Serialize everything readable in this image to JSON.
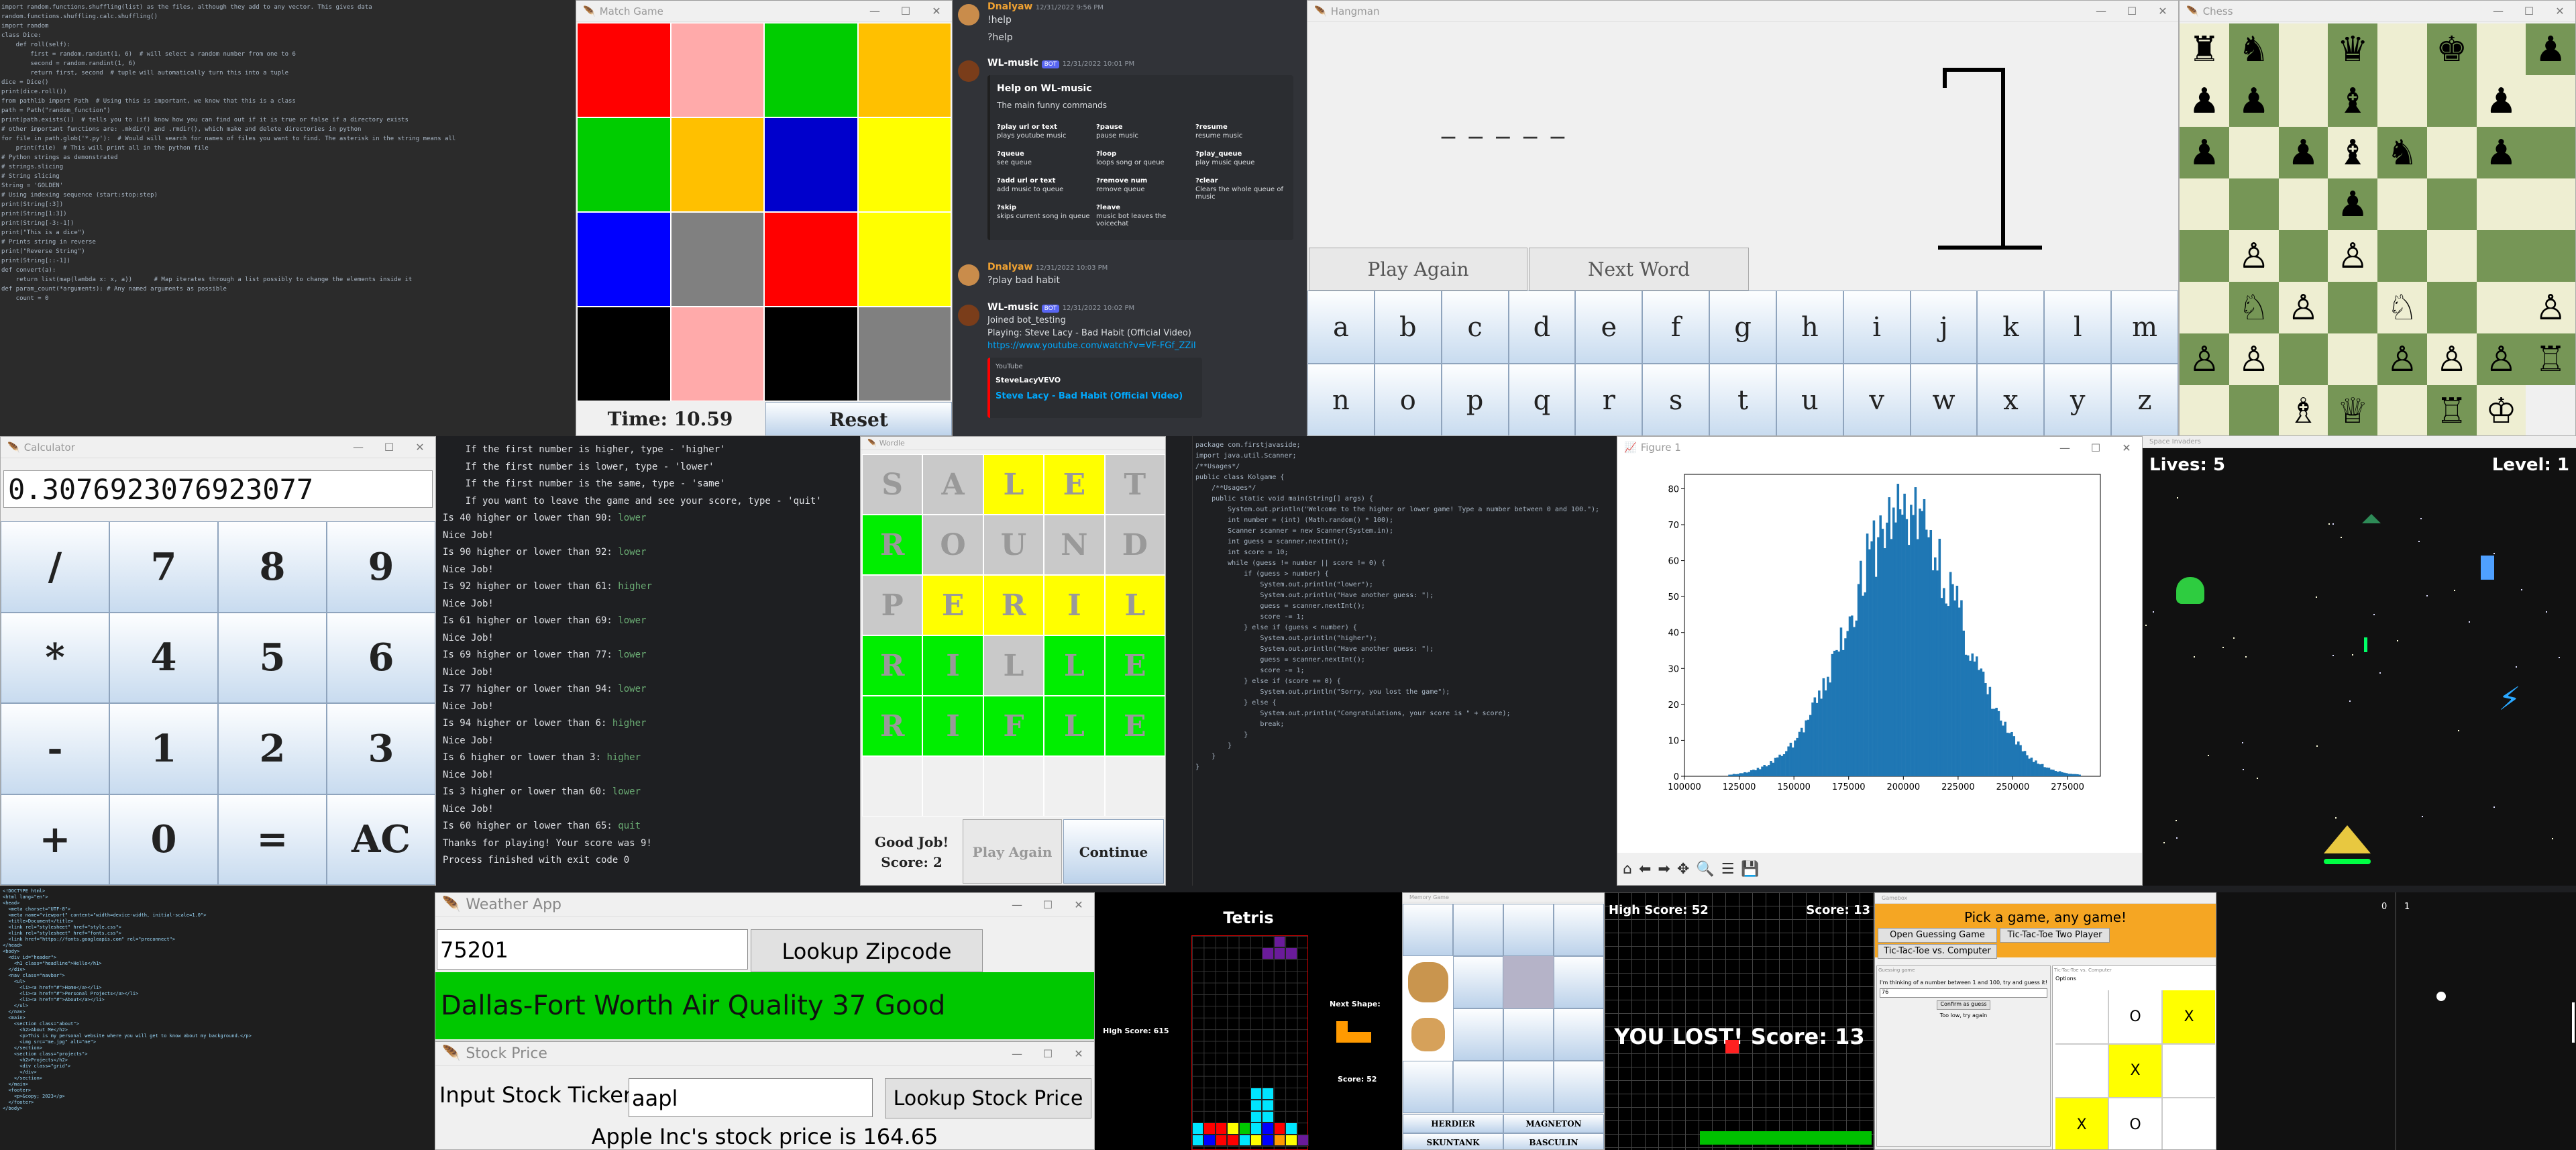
{
  "editor_tl": {
    "lines": [
      "import random.functions.shuffling(list) as the files, although they add to any vector. This gives data",
      "random.functions.shuffling.calc.shuffling()",
      "",
      "import random",
      "",
      "",
      "class Dice:",
      "    def roll(self):",
      "        first = random.randint(1, 6)  # will select a random number from one to 6",
      "        second = random.randint(1, 6)",
      "        return first, second  # tuple will automatically turn this into a tuple",
      "",
      "dice = Dice()",
      "print(dice.roll())",
      "",
      "from pathlib import Path  # Using this is important, we know that this is a class",
      "",
      "path = Path(\"random_function\")",
      "print(path.exists())  # tells you to (if) know how you can find out if it is true or false if a directory exists",
      "# other important functions are: .mkdir() and .rmdir(), which make and delete directories in python",
      "",
      "for file in path.glob('*.py'):  # Would will search for names of files you want to find. The asterisk in the string means all",
      "    print(file)  # This will print all in the python file",
      "",
      "# Python strings as demonstrated",
      "# strings.slicing",
      "",
      "# String slicing",
      "String = 'GOLDEN'",
      "",
      "# Using indexing sequence (start:stop:step)",
      "print(String[:3])",
      "print(String[1:3])",
      "print(String[-3:-1])",
      "print(\"This is a dice\")",
      "",
      "# Prints string in reverse",
      "print(\"Reverse String\")",
      "print(String[::-1])",
      "",
      "",
      "def convert(a):",
      "    return list(map(lambda x: x, a))      # Map iterates through a list possibly to change the elements inside it",
      "",
      "def param_count(*arguments): # Any named arguments as possible",
      "    count = 0"
    ]
  },
  "match_game": {
    "title": "Match Game",
    "colors": [
      "#ff0000",
      "#ffaaaa",
      "#00cc00",
      "#ffc000",
      "#00cc00",
      "#ffc000",
      "#0000cc",
      "#ffff00",
      "#0000ff",
      "#808080",
      "#ff0000",
      "#ffff00",
      "#000000",
      "#ffaaaa",
      "#000000",
      "#808080"
    ],
    "time": "Time: 10.59",
    "reset": "Reset"
  },
  "discord": {
    "messages": [
      {
        "user": "Dnalyaw",
        "time": "12/31/2022 9:56 PM",
        "lines": [
          "!help",
          "?help"
        ]
      },
      {
        "user": "WL-music",
        "bot": "BOT",
        "time": "12/31/2022 10:01 PM"
      },
      {
        "user": "Dnalyaw",
        "time": "12/31/2022 10:03 PM",
        "lines": [
          "?play bad habit"
        ]
      },
      {
        "user": "WL-music",
        "bot": "BOT",
        "time": "12/31/2022 10:02 PM",
        "lines": [
          "Joined bot_testing",
          "Playing: Steve Lacy - Bad Habit (Official Video)"
        ]
      }
    ],
    "help_title": "Help on WL-music",
    "help_sub": "The main funny commands",
    "commands": [
      [
        "?play url or text",
        "plays youtube music"
      ],
      [
        "?pause",
        "pause music"
      ],
      [
        "?resume",
        "resume music"
      ],
      [
        "?queue",
        "see queue"
      ],
      [
        "?loop",
        "loops song or queue"
      ],
      [
        "?play_queue",
        "play music queue"
      ],
      [
        "?add url or text",
        "add music to queue"
      ],
      [
        "?remove num",
        "remove queue"
      ],
      [
        "?clear",
        "Clears the whole queue of music"
      ],
      [
        "?skip",
        "skips current song in queue"
      ],
      [
        "?leave",
        "music bot leaves the voicechat"
      ]
    ],
    "link": "https://www.youtube.com/watch?v=VF-FGf_ZZiI",
    "embed_site": "YouTube",
    "embed_channel": "SteveLacyVEVO",
    "embed_title": "Steve Lacy - Bad Habit (Official Video)"
  },
  "hangman": {
    "title": "Hangman",
    "blanks": "_ _ _ _ _",
    "play_again": "Play Again",
    "next_word": "Next Word",
    "letters": [
      "a",
      "b",
      "c",
      "d",
      "e",
      "f",
      "g",
      "h",
      "i",
      "j",
      "k",
      "l",
      "m",
      "n",
      "o",
      "p",
      "q",
      "r",
      "s",
      "t",
      "u",
      "v",
      "w",
      "x",
      "y",
      "z"
    ]
  },
  "chess": {
    "title": "Chess",
    "board": [
      "♜♞ ♛ ♚ ",
      "♟♟♟ ♝  ♟",
      " ♟ ♟♝♞ ♟",
      "    ♟   ",
      "  ♙ ♙   ",
      "  ♘♙ ♘  ",
      "♙♙♙  ♙♙♙",
      "♖  ♗♕ ♖♔"
    ]
  },
  "calculator": {
    "title": "Calculator",
    "display": "0.3076923076923077",
    "keys": [
      "/",
      "7",
      "8",
      "9",
      "*",
      "4",
      "5",
      "6",
      "-",
      "1",
      "2",
      "3",
      "+",
      "0",
      "=",
      "AC"
    ]
  },
  "console": {
    "lines": [
      [
        "    If the first number is higher, type - 'higher'",
        ""
      ],
      [
        "    If the first number is lower, type - 'lower'",
        ""
      ],
      [
        "    If the first number is the same, type - 'same'",
        ""
      ],
      [
        "    If you want to leave the game and see your score, type - 'quit'",
        ""
      ],
      [
        "Is 40 higher or lower than 90: ",
        "lower"
      ],
      [
        "Nice Job!",
        ""
      ],
      [
        "Is 90 higher or lower than 92: ",
        "lower"
      ],
      [
        "Nice Job!",
        ""
      ],
      [
        "Is 92 higher or lower than 61: ",
        "higher"
      ],
      [
        "Nice Job!",
        ""
      ],
      [
        "Is 61 higher or lower than 69: ",
        "lower"
      ],
      [
        "Nice Job!",
        ""
      ],
      [
        "Is 69 higher or lower than 77: ",
        "lower"
      ],
      [
        "Nice Job!",
        ""
      ],
      [
        "Is 77 higher or lower than 94: ",
        "lower"
      ],
      [
        "Nice Job!",
        ""
      ],
      [
        "Is 94 higher or lower than 6: ",
        "higher"
      ],
      [
        "Nice Job!",
        ""
      ],
      [
        "Is 6 higher or lower than 3: ",
        "higher"
      ],
      [
        "Nice Job!",
        ""
      ],
      [
        "Is 3 higher or lower than 60: ",
        "lower"
      ],
      [
        "Nice Job!",
        ""
      ],
      [
        "Is 60 higher or lower than 65: ",
        "quit"
      ],
      [
        "Thanks for playing! Your score was 9!",
        ""
      ],
      [
        "",
        ""
      ],
      [
        "Process finished with exit code 0",
        ""
      ]
    ]
  },
  "wordle": {
    "title": "Wordle",
    "grid": [
      [
        "S",
        "#c9c9c9"
      ],
      [
        "A",
        "#c9c9c9"
      ],
      [
        "L",
        "#ffff00"
      ],
      [
        "E",
        "#ffff00"
      ],
      [
        "T",
        "#c9c9c9"
      ],
      [
        "R",
        "#00ee00"
      ],
      [
        "O",
        "#c9c9c9"
      ],
      [
        "U",
        "#c9c9c9"
      ],
      [
        "N",
        "#c9c9c9"
      ],
      [
        "D",
        "#c9c9c9"
      ],
      [
        "P",
        "#c9c9c9"
      ],
      [
        "E",
        "#ffff00"
      ],
      [
        "R",
        "#ffff00"
      ],
      [
        "I",
        "#ffff00"
      ],
      [
        "L",
        "#ffff00"
      ],
      [
        "R",
        "#00ee00"
      ],
      [
        "I",
        "#00ee00"
      ],
      [
        "L",
        "#c9c9c9"
      ],
      [
        "L",
        "#00ee00"
      ],
      [
        "E",
        "#00ee00"
      ],
      [
        "R",
        "#00ee00"
      ],
      [
        "I",
        "#00ee00"
      ],
      [
        "F",
        "#00ee00"
      ],
      [
        "L",
        "#00ee00"
      ],
      [
        "E",
        "#00ee00"
      ],
      [
        "",
        "#f0f0f0"
      ],
      [
        "",
        "#f0f0f0"
      ],
      [
        "",
        "#f0f0f0"
      ],
      [
        "",
        "#f0f0f0"
      ],
      [
        "",
        "#f0f0f0"
      ]
    ],
    "result1": "Good Job!",
    "result2": "Score: 2",
    "play_again": "Play Again",
    "continue": "Continue"
  },
  "java": {
    "lines": [
      "package com.firstjavaside;",
      "",
      "import java.util.Scanner;",
      "",
      "/**Usages*/",
      "public class Kolgame {",
      "    /**Usages*/",
      "    public static void main(String[] args) {",
      "        System.out.println(\"Welcome to the higher or lower game! Type a number between 0 and 100.\");",
      "        int number = (int) (Math.random() * 100);",
      "",
      "        Scanner scanner = new Scanner(System.in);",
      "",
      "        int guess = scanner.nextInt();",
      "        int score = 10;",
      "",
      "        while (guess != number || score != 0) {",
      "            if (guess > number) {",
      "                System.out.println(\"lower\");",
      "                System.out.println(\"Have another guess: \");",
      "                guess = scanner.nextInt();",
      "                score -= 1;",
      "",
      "",
      "            } else if (guess < number) {",
      "                System.out.println(\"higher\");",
      "                System.out.println(\"Have another guess: \");",
      "                guess = scanner.nextInt();",
      "                score -= 1;",
      "            } else if (score == 0) {",
      "                System.out.println(\"Sorry, you lost the game\");",
      "            } else {",
      "                System.out.println(\"Congratulations, your score is \" + score);",
      "                break;",
      "            }",
      "        }",
      "    }",
      "}"
    ]
  },
  "figure": {
    "title": "Figure 1"
  },
  "chart_data": {
    "type": "bar",
    "title": "",
    "xlabel": "",
    "ylabel": "",
    "xlim": [
      100000,
      290000
    ],
    "ylim": [
      0,
      84
    ],
    "xticks": [
      100000,
      125000,
      150000,
      175000,
      200000,
      225000,
      250000,
      275000
    ],
    "yticks": [
      0,
      10,
      20,
      30,
      40,
      50,
      60,
      70,
      80
    ],
    "bin_width": 1000,
    "distribution": "normal",
    "center": 200000,
    "sd": 25000,
    "peak": 76
  },
  "space": {
    "title": "Space Invaders",
    "lives": "Lives: 5",
    "level": "Level: 1"
  },
  "html_editor": {
    "lines": [
      "<!DOCTYPE html>",
      "<html lang=\"en\">",
      "<head>",
      "  <meta charset=\"UTF-8\">",
      "  <meta name=\"viewport\" content=\"width=device-width, initial-scale=1.0\">",
      "  <title>Document</title>",
      "  <link rel=\"stylesheet\" href=\"style.css\">",
      "  <link rel=\"stylesheet\" href=\"fonts.css\">",
      "  <link href=\"https://fonts.googleapis.com\" rel=\"preconnect\">",
      "",
      "</head>",
      "<body>",
      "",
      "  <div id=\"header\">",
      "    <h1 class=\"headline\">Hello</h1>",
      "  </div>",
      "",
      "  <nav class=\"navbar\">",
      "    <ul>",
      "      <li><a href=\"#\">Home</a></li>",
      "      <li><a href=\"#\">Personal Projects</a></li>",
      "      <li><a href=\"#\">About</a></li>",
      "    </ul>",
      "  </nav>",
      "",
      "  <main>",
      "    <section class=\"about\">",
      "      <h2>About Me</h2>",
      "      <p>This is my personal website where you will get to know about my background.</p>",
      "      <img src=\"me.jpg\" alt=\"me\">",
      "    </section>",
      "",
      "    <section class=\"projects\">",
      "      <h2>Projects</h2>",
      "      <div class=\"grid\">",
      "",
      "      </div>",
      "    </section>",
      "  </main>",
      "",
      "  <footer>",
      "    <p>&copy; 2023</p>",
      "  </footer>",
      "</body>"
    ]
  },
  "weather": {
    "title": "Weather App",
    "zip": "75201",
    "lookup": "Lookup Zipcode",
    "result": "Dallas-Fort Worth Air Quality 37 Good"
  },
  "stock": {
    "title": "Stock Price",
    "label": "Input Stock Ticker:",
    "ticker": "aapl",
    "lookup": "Lookup Stock Price",
    "result": "Apple Inc's stock price is 164.65"
  },
  "tetris": {
    "title": "Tetris",
    "high": "High Score: 615",
    "next": "Next Shape:",
    "score": "Score: 52"
  },
  "puzzle": {
    "title": "Memory Game",
    "names": [
      "HERDIER",
      "MAGNETON",
      "SKUNTANK",
      "BASCULIN"
    ]
  },
  "snake": {
    "high": "High Score: 52",
    "score": "Score: 13",
    "lost": "YOU LOST! Score: 13"
  },
  "launcher": {
    "title": "Gamebox",
    "pick": "Pick a game, any game!",
    "b1": "Open Guessing Game",
    "b2": "Tic-Tac-Toe Two Player",
    "b3": "Tic-Tac-Toe vs. Computer",
    "guess_title": "Guessing game",
    "guess_text": "I'm thinking of a number between 1 and 100, try and guess it!",
    "guess_value": "76",
    "confirm": "Confirm as guess",
    "toolow": "Too low, try again",
    "ttt_title": "Tic-Tac-Toe vs. Computer",
    "ttt_cells": [
      "",
      "O",
      "X",
      "",
      "X",
      "",
      "X",
      "O",
      ""
    ],
    "options": "Options"
  },
  "pong": {
    "score_left": "0",
    "score_right": "1"
  }
}
